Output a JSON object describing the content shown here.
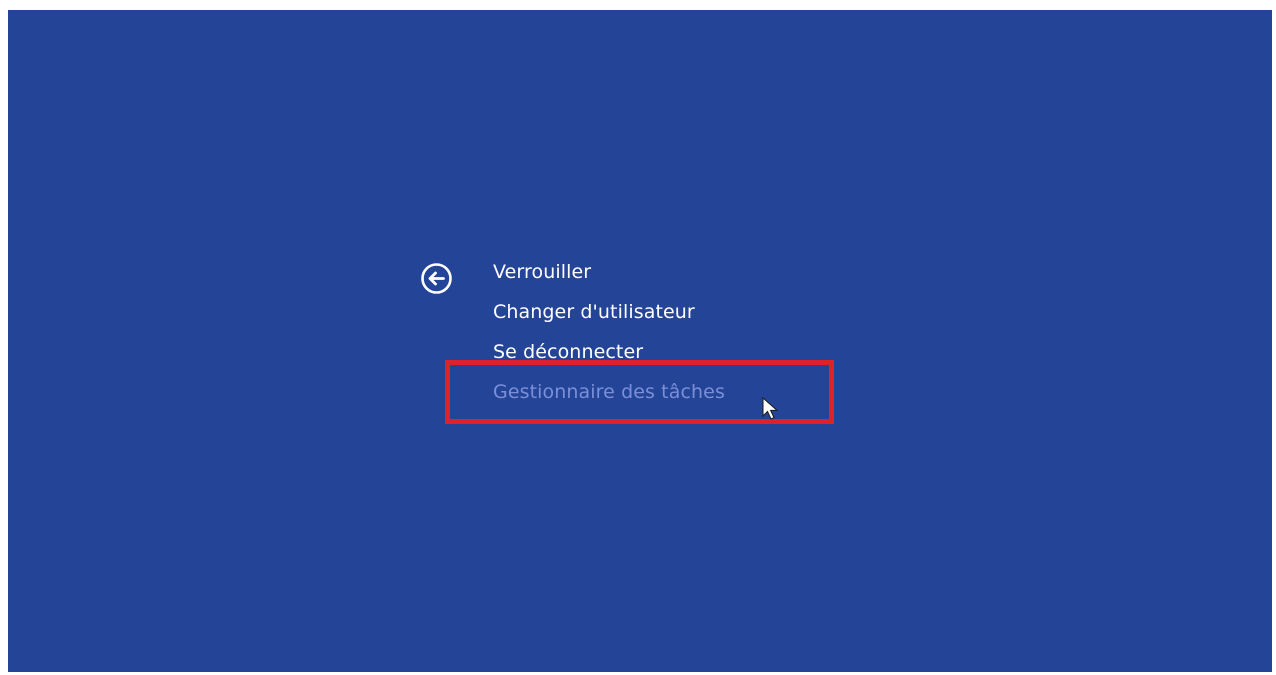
{
  "screen": {
    "background_color": "#244497"
  },
  "back_button": {
    "icon": "arrow-left-circle-icon"
  },
  "menu": {
    "items": [
      {
        "label": "Verrouiller",
        "state": "normal"
      },
      {
        "label": "Changer d'utilisateur",
        "state": "normal"
      },
      {
        "label": "Se déconnecter",
        "state": "normal"
      },
      {
        "label": "Gestionnaire des tâches",
        "state": "hovered"
      }
    ]
  },
  "annotation": {
    "highlight_color": "#e0202c"
  },
  "colors": {
    "text": "#ffffff",
    "hover_text": "#7b8fd8"
  }
}
